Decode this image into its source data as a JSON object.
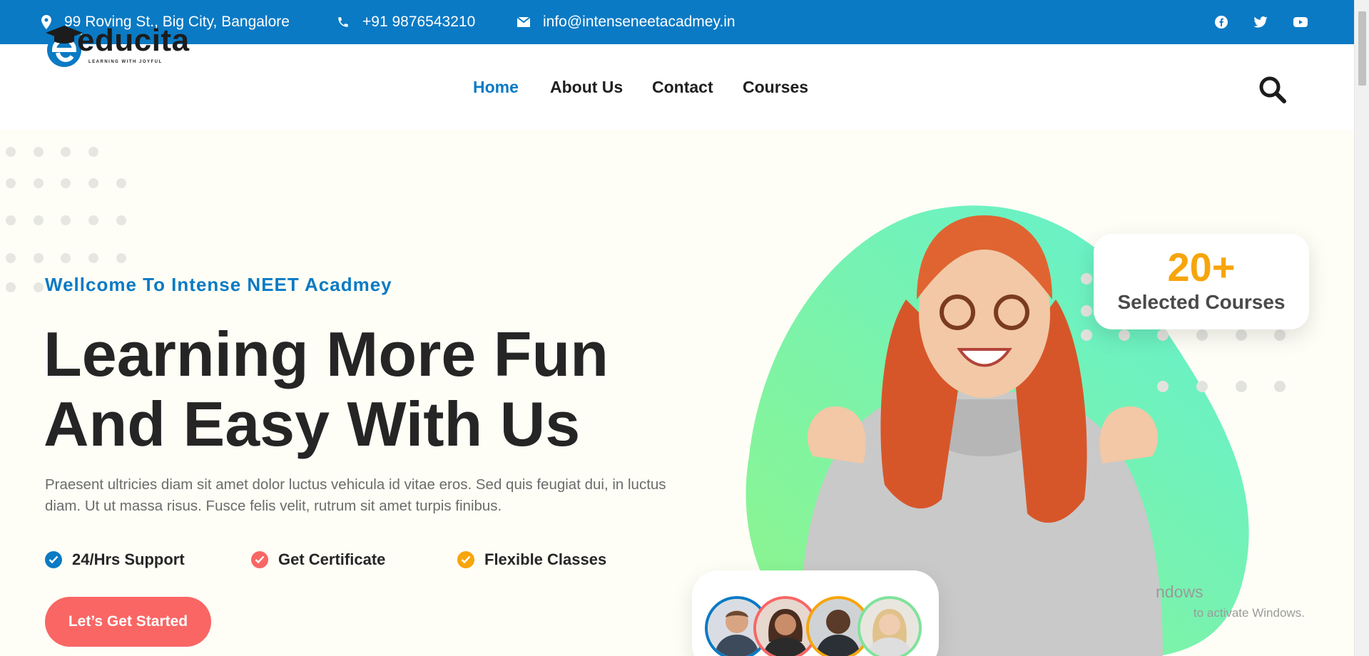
{
  "topbar": {
    "address": "99 Roving St., Big City, Bangalore",
    "phone": "+91 9876543210",
    "email": "info@intenseneetacadmey.in",
    "social": [
      "facebook-icon",
      "twitter-icon",
      "youtube-icon"
    ],
    "bg_color": "#0a7ac4"
  },
  "header": {
    "logo_text": "educita",
    "logo_tagline": "LEARNING WITH JOYFUL",
    "nav": [
      {
        "label": "Home",
        "active": true
      },
      {
        "label": "About Us"
      },
      {
        "label": "Contact"
      },
      {
        "label": "Courses"
      }
    ],
    "search_icon": "search-icon"
  },
  "hero": {
    "welcome": "Wellcome To Intense NEET Acadmey",
    "headline_line1": "Learning More Fun",
    "headline_line2": "And Easy With Us",
    "description": "Praesent ultricies diam sit amet dolor luctus vehicula id vitae eros. Sed quis feugiat dui, in luctus diam. Ut ut massa risus. Fusce felis velit, rutrum sit amet turpis finibus.",
    "features": [
      {
        "label": "24/Hrs Support",
        "color": "#0a7ac4"
      },
      {
        "label": "Get Certificate",
        "color": "#f96664"
      },
      {
        "label": "Flexible Classes",
        "color": "#f6a50b"
      }
    ],
    "cta_label": "Let’s Get Started",
    "cta_color": "#f96664"
  },
  "stats_card": {
    "number": "20+",
    "label": "Selected Courses",
    "number_color": "#f6a50b"
  },
  "students": {
    "avatar_borders": [
      "#0a7ac4",
      "#f96664",
      "#f6a50b",
      "#7fe39a"
    ]
  },
  "os_watermark": {
    "line1": "ndows",
    "line2": "to activate Windows."
  }
}
